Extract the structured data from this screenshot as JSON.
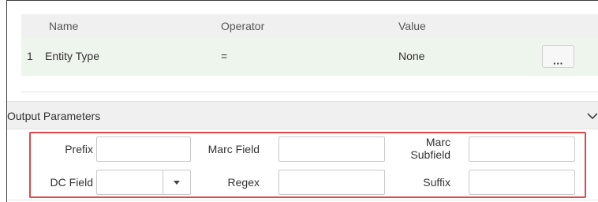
{
  "conditions": {
    "headers": {
      "name": "Name",
      "operator": "Operator",
      "value": "Value"
    },
    "rows": [
      {
        "index": "1",
        "name": "Entity Type",
        "operator": "=",
        "value": "None",
        "action_label": "···"
      }
    ]
  },
  "output_parameters": {
    "title": "Output Parameters",
    "fields": {
      "prefix": {
        "label": "Prefix",
        "value": ""
      },
      "marc_field": {
        "label": "Marc Field",
        "value": ""
      },
      "marc_subfield": {
        "label_line1": "Marc",
        "label_line2": "Subfield",
        "value": ""
      },
      "dc_field": {
        "label": "DC Field",
        "selected": ""
      },
      "regex": {
        "label": "Regex",
        "value": ""
      },
      "suffix": {
        "label": "Suffix",
        "value": ""
      }
    }
  },
  "colors": {
    "highlight_border": "#e04848",
    "row_background": "#eef5ec",
    "header_background": "#f0f0f0"
  }
}
